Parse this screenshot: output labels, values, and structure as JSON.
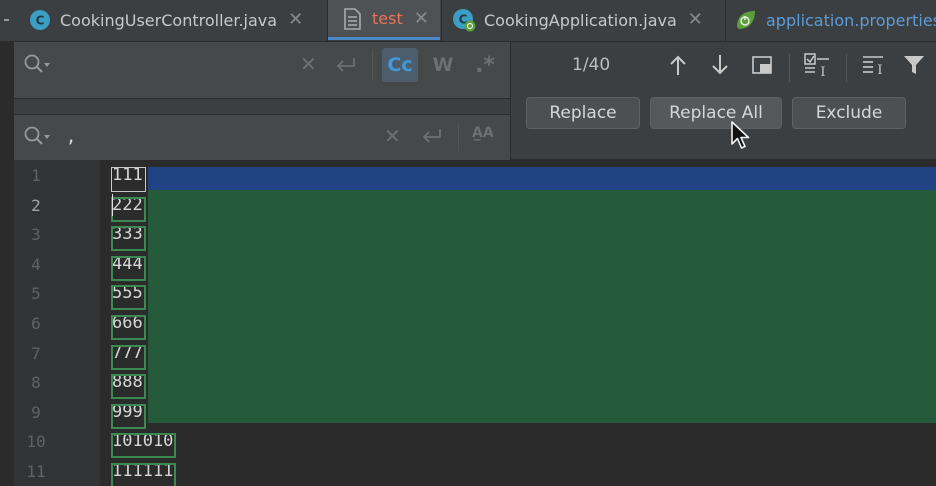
{
  "tabs": [
    {
      "label": "CookingUserController.java",
      "icon": "class-c-icon",
      "active": false
    },
    {
      "label": "test",
      "icon": "text-file-icon",
      "active": true
    },
    {
      "label": "CookingApplication.java",
      "icon": "spring-class-icon",
      "active": false
    },
    {
      "label": "application.properties",
      "icon": "spring-leaf-icon",
      "active": false
    }
  ],
  "find": {
    "search_value": "",
    "replace_value": ",",
    "match_case_label": "Cc",
    "words_label": "W",
    "regex_label": ".*",
    "preserve_case_label": "A̲A",
    "match_count": "1/40",
    "replace_label": "Replace",
    "replace_all_label": "Replace All",
    "exclude_label": "Exclude"
  },
  "editor": {
    "current_line": 2,
    "lines": [
      {
        "num": "1",
        "text": "111"
      },
      {
        "num": "2",
        "text": "222"
      },
      {
        "num": "3",
        "text": "333"
      },
      {
        "num": "4",
        "text": "444"
      },
      {
        "num": "5",
        "text": "555"
      },
      {
        "num": "6",
        "text": "666"
      },
      {
        "num": "7",
        "text": "777"
      },
      {
        "num": "8",
        "text": "888"
      },
      {
        "num": "9",
        "text": "999"
      },
      {
        "num": "10",
        "text": "101010"
      },
      {
        "num": "11",
        "text": "111111"
      }
    ]
  },
  "colors": {
    "active_tab_label": "#e8735a",
    "selection_blue": "#214283",
    "selection_green": "#255a3b",
    "accent": "#4a88c7"
  }
}
